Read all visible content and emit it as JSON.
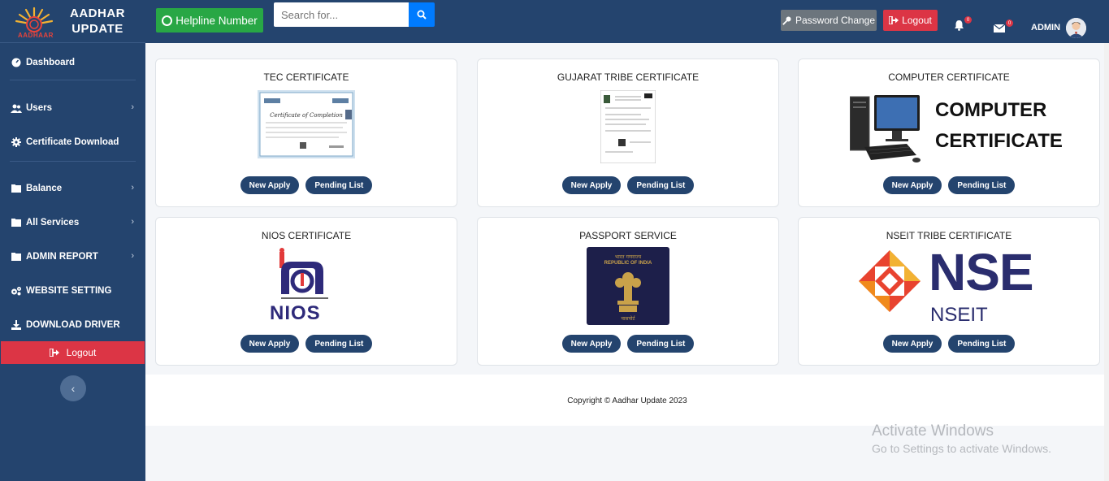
{
  "brand": {
    "title_line1": "AADHAR",
    "title_line2": "UPDATE",
    "logo_text": "AADHAAR"
  },
  "topbar": {
    "helpline_label": "Helpline Number",
    "search_placeholder": "Search for...",
    "password_change_label": "Password Change",
    "logout_label": "Logout",
    "notification_count": "0",
    "message_count": "0",
    "admin_name": "ADMIN"
  },
  "sidebar": {
    "items": [
      {
        "label": "Dashboard",
        "icon": "dashboard-icon"
      },
      {
        "label": "Users",
        "icon": "users-icon",
        "has_submenu": true
      },
      {
        "label": "Certificate Download",
        "icon": "cog-icon"
      },
      {
        "label": "Balance",
        "icon": "folder-icon",
        "has_submenu": true
      },
      {
        "label": "All Services",
        "icon": "folder-icon",
        "has_submenu": true
      },
      {
        "label": "ADMIN REPORT",
        "icon": "folder-icon",
        "has_submenu": true
      },
      {
        "label": "WEBSITE SETTING",
        "icon": "cogs-icon"
      },
      {
        "label": "DOWNLOAD DRIVER",
        "icon": "download-icon"
      }
    ],
    "logout_label": "Logout"
  },
  "cards": [
    {
      "title": "TEC CERTIFICATE",
      "image": "tec-certificate-image",
      "image_text": "Certificate of Completion",
      "new_apply": "New Apply",
      "pending_list": "Pending List"
    },
    {
      "title": "GUJARAT TRIBE CERTIFICATE",
      "image": "gujarat-tribe-certificate-image",
      "new_apply": "New Apply",
      "pending_list": "Pending List"
    },
    {
      "title": "COMPUTER CERTIFICATE",
      "image": "computer-certificate-image",
      "image_text_line1": "COMPUTER",
      "image_text_line2": "CERTIFICATE",
      "new_apply": "New Apply",
      "pending_list": "Pending List"
    },
    {
      "title": "NIOS CERTIFICATE",
      "image": "nios-logo-image",
      "image_text": "NIOS",
      "new_apply": "New Apply",
      "pending_list": "Pending List"
    },
    {
      "title": "PASSPORT SERVICE",
      "image": "passport-image",
      "image_text_line1": "भारत गणराज्य",
      "image_text_line2": "REPUBLIC OF INDIA",
      "image_text_line3": "पासपोर्ट",
      "new_apply": "New Apply",
      "pending_list": "Pending List"
    },
    {
      "title": "NSEIT TRIBE CERTIFICATE",
      "image": "nseit-logo-image",
      "image_text_line1": "NSE",
      "image_text_line2": "NSEIT",
      "new_apply": "New Apply",
      "pending_list": "Pending List"
    }
  ],
  "footer": {
    "copyright": "Copyright © Aadhar Update 2023"
  },
  "watermark": {
    "line1": "Activate Windows",
    "line2": "Go to Settings to activate Windows."
  },
  "colors": {
    "sidebar": "#24446e",
    "accent_green": "#28a745",
    "danger": "#dc3545",
    "primary": "#007bff",
    "pill": "#24446e"
  }
}
